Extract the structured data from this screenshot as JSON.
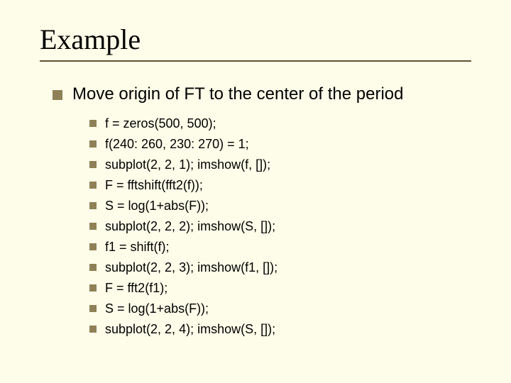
{
  "title": "Example",
  "main_bullet": "Move origin of FT to the center of the period",
  "sub_bullets": [
    "f = zeros(500, 500);",
    "f(240: 260, 230: 270) = 1;",
    "subplot(2, 2, 1); imshow(f, []);",
    "F = fftshift(fft2(f));",
    "S = log(1+abs(F));",
    "subplot(2, 2, 2); imshow(S, []);",
    "f1 = shift(f);",
    "subplot(2, 2, 3); imshow(f1, []);",
    "F = fft2(f1);",
    "S = log(1+abs(F));",
    "subplot(2, 2, 4); imshow(S, []);"
  ]
}
